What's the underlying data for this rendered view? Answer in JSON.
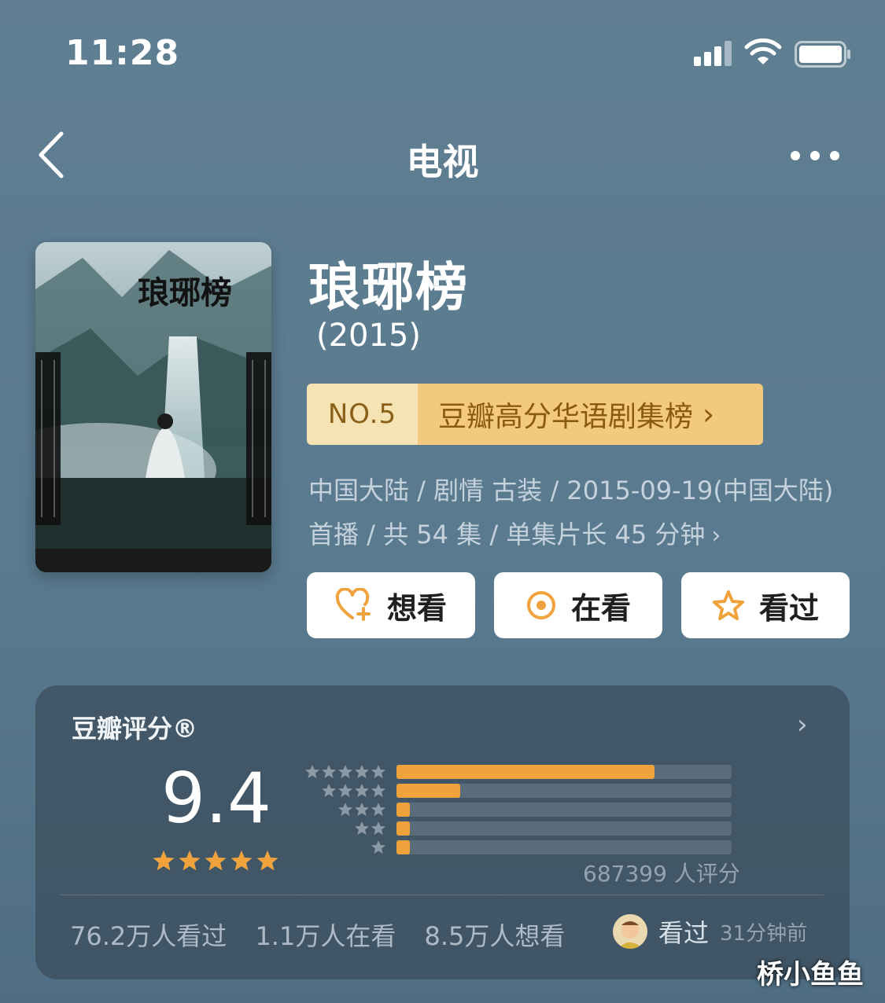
{
  "status_bar": {
    "time": "11:28",
    "signal_icon": "cellular-signal-icon",
    "wifi_icon": "wifi-icon",
    "battery_icon": "battery-icon"
  },
  "nav": {
    "back_icon": "chevron-left-icon",
    "title": "电视",
    "more_icon": "more-dots-icon"
  },
  "movie": {
    "poster_title": "琅琊榜",
    "title": "琅琊榜",
    "year": "(2015)",
    "rank": {
      "number": "NO.5",
      "list_name": "豆瓣高分华语剧集榜",
      "chevron": "›"
    },
    "meta_line1": "中国大陆 / 剧情 古装 / 2015-09-19(中国大陆)",
    "meta_line2": "首播 / 共 54 集 / 单集片长 45 分钟",
    "meta_chevron": "›"
  },
  "actions": [
    {
      "label": "想看",
      "icon": "heart-plus-icon"
    },
    {
      "label": "在看",
      "icon": "target-circle-icon"
    },
    {
      "label": "看过",
      "icon": "star-outline-icon"
    }
  ],
  "rating": {
    "label": "豆瓣评分®",
    "chevron": "›",
    "score": "9.4",
    "star_fraction": 0.94,
    "distribution": [
      {
        "stars": 5,
        "fraction": 0.77
      },
      {
        "stars": 4,
        "fraction": 0.19
      },
      {
        "stars": 3,
        "fraction": 0.03
      },
      {
        "stars": 2,
        "fraction": 0.03
      },
      {
        "stars": 1,
        "fraction": 0.03
      }
    ],
    "count_text": "687399 人评分",
    "stats": {
      "watched": "76.2万人看过",
      "watching": "1.1万人在看",
      "want": "8.5万人想看"
    },
    "friend": {
      "status": "看过",
      "time": "31分钟前"
    }
  },
  "colors": {
    "accent_orange": "#f0a33d",
    "rank_badge_left": "#f6e3b4",
    "rank_badge_right": "#f3c97f"
  },
  "watermark": "桥小鱼鱼"
}
